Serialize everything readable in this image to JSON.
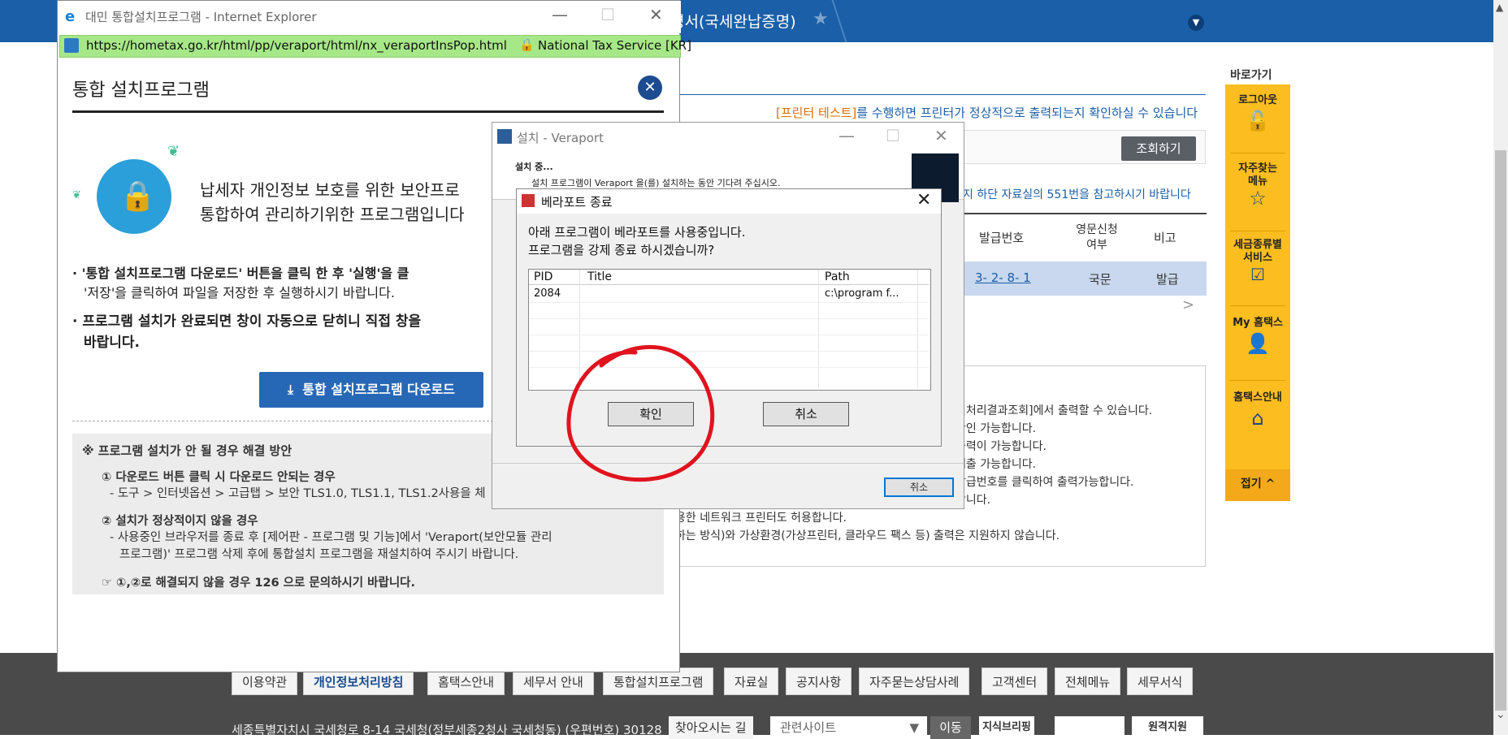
{
  "background_page": {
    "breadcrumb": "명서(국세완납증명)",
    "printer_notice_highlight": "[프린터 테스트]",
    "printer_notice_rest": "를 수행하면 프린터가 정상적으로 출력되는지 확인하실 수 있습니다",
    "query_button": "조회하기",
    "notice_551": "지 하단 자료실의 551번을 참고하시기 바랍니다",
    "table": {
      "headers": [
        "발급번호",
        "영문신청\n여부",
        "비고"
      ],
      "row": {
        "number": "3-  2-  8-  1",
        "english": "국문",
        "remark": "발급"
      }
    },
    "info_lines": [
      "민처리결과조회]에서 출력할 수 있습니다.",
      "확인 가능합니다.",
      "출력이 가능합니다.",
      "제출 가능합니다.",
      "발급번호를 클릭하여 출력가능합니다.",
      "합니다.",
      "용한 네트워크 프린터도 허용합니다.",
      "하는 방식)와 가상환경(가상프린터, 클라우드 팩스 등) 출력은 지원하지 않습니다."
    ]
  },
  "quick_menu": {
    "title": "바로가기",
    "items": [
      {
        "label": "로그아웃",
        "icon": "lock-open-icon"
      },
      {
        "label": "자주찾는\n메뉴",
        "icon": "star-icon"
      },
      {
        "label": "세금종류별\n서비스",
        "icon": "checkbox-icon"
      },
      {
        "label": "My 홈택스",
        "icon": "person-icon"
      },
      {
        "label": "홈택스안내",
        "icon": "home-icon"
      }
    ],
    "fold": "접기 ^"
  },
  "footer": {
    "links": [
      "이용약관",
      "개인정보처리방침",
      "홈택스안내",
      "세무서 안내",
      "통합설치프로그램",
      "자료실",
      "공지사항",
      "자주묻는상담사례",
      "고객센터",
      "전체메뉴",
      "세무서식"
    ],
    "address": "세종특별자치시 국세청로 8-14 국세청(정부세종2청사 국세청동) (우편번호) 30128",
    "find_way": "찾아오시는 길",
    "related_sites": "관련사이트",
    "go": "이동",
    "banners": [
      "지식브리핑",
      "",
      "원격지원"
    ]
  },
  "ie_popup": {
    "title": "대민 통합설치프로그램 - Internet Explorer",
    "url": "https://hometax.go.kr/html/pp/veraport/html/nx_veraportInsPop.html",
    "ssl": "National Tax Service [KR]",
    "heading": "통합 설치프로그램",
    "intro_line1": "납세자 개인정보 보호를 위한 보안프로",
    "intro_line2": "통합하여 관리하기위한 프로그램입니다",
    "bullet1_line1": "· '통합 설치프로그램 다운로드' 버튼을 클릭 한 후 '실행'을 클",
    "bullet1_line2": "'저장'을 클릭하여 파일을 저장한 후 실행하시기 바랍니다.",
    "bullet2_line1": "· 프로그램 설치가 완료되면 창이 자동으로 닫히니 직접 창을",
    "bullet2_line2": "바랍니다.",
    "download_button": "통합 설치프로그램 다운로드",
    "help": {
      "title": "※ 프로그램 설치가 안 될 경우 해결 방안",
      "case1_title": "① 다운로드 버튼 클릭 시 다운로드 안되는 경우",
      "case1_text": "- 도구 > 인터넷옵션 > 고급탭 > 보안 TLS1.0, TLS1.1, TLS1.2사용을 체",
      "case2_title": "② 설치가 정상적이지 않을 경우",
      "case2_text1": "- 사용중인 브라우저를 종료 후 [제어판 - 프로그램 및 기능]에서 'Veraport(보안모듈 관리",
      "case2_text2": "프로그램)' 프로그램 삭제 후에 통합설치 프로그램을 재설치하여 주시기 바랍니다.",
      "contact": "☞ ①,②로 해결되지 않을 경우 126 으로 문의하시기 바랍니다."
    }
  },
  "install_window": {
    "title": "설치 - Veraport",
    "status": "설치 중...",
    "detail": "설치 프로그램이 Veraport 을(를) 설치하는 동안 기다려 주십시오.",
    "cancel": "취소"
  },
  "terminate_dialog": {
    "title": "베라포트 종료",
    "message_line1": "아래 프로그램이 베라포트를 사용중입니다.",
    "message_line2": "프로그램을 강제 종료 하시겠습니까?",
    "columns": [
      "PID",
      "Title",
      "Path"
    ],
    "rows": [
      {
        "pid": "2084",
        "title": "",
        "path": "c:\\program f..."
      }
    ],
    "ok": "확인",
    "cancel": "취소"
  },
  "colors": {
    "brand_blue": "#1a5fa8",
    "quick_yellow": "#fbbd1f",
    "annotation_red": "#e0141e"
  }
}
